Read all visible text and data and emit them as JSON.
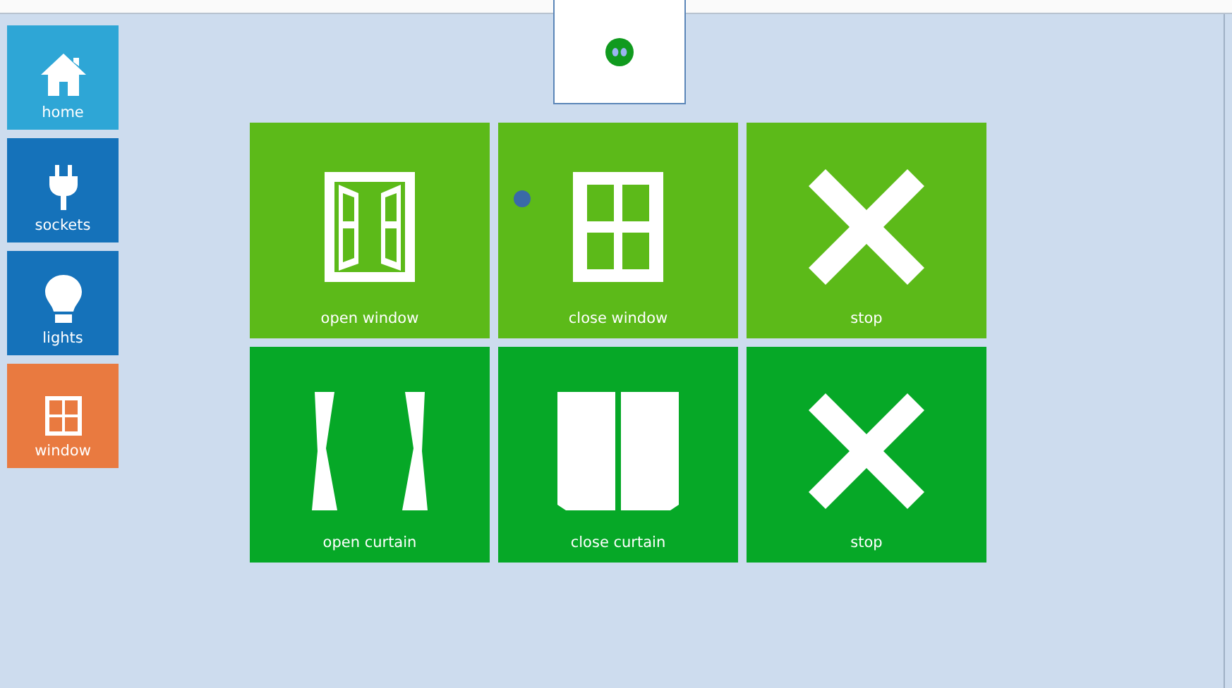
{
  "sidebar": {
    "items": [
      {
        "label": "home",
        "kind": "home",
        "color": "#2ea6d6"
      },
      {
        "label": "sockets",
        "kind": "plug",
        "color": "#1572ba"
      },
      {
        "label": "lights",
        "kind": "bulb",
        "color": "#1572ba"
      },
      {
        "label": "window",
        "kind": "window",
        "color": "#e97a40"
      }
    ]
  },
  "tiles": [
    {
      "label": "open window",
      "kind": "open-window",
      "color": "#5cba19"
    },
    {
      "label": "close window",
      "kind": "close-window",
      "color": "#5cba19"
    },
    {
      "label": "stop",
      "kind": "stop",
      "color": "#5cba19"
    },
    {
      "label": "open curtain",
      "kind": "open-curtain",
      "color": "#06a827"
    },
    {
      "label": "close curtain",
      "kind": "close-curtain",
      "color": "#06a827"
    },
    {
      "label": "stop",
      "kind": "stop",
      "color": "#06a827"
    }
  ]
}
